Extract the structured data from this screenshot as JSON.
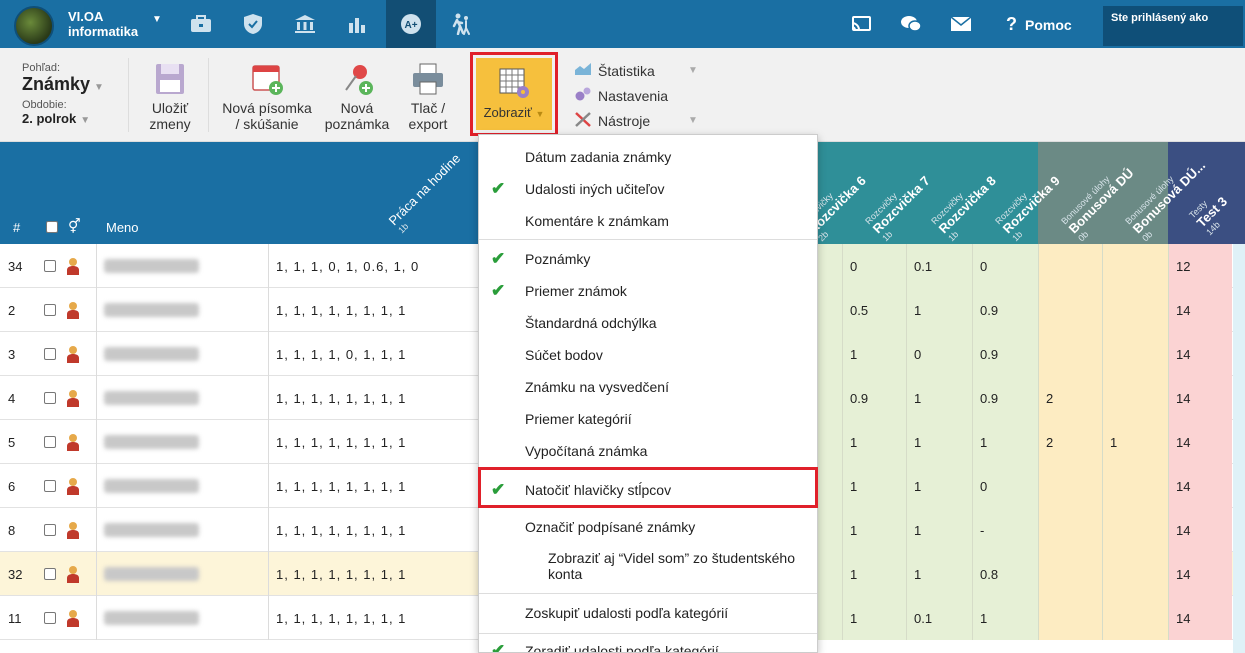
{
  "app": {
    "name_line1": "VI.OA",
    "name_line2": "informatika"
  },
  "nav": {
    "icons": [
      "briefcase-icon",
      "shield-icon",
      "bank-icon",
      "bar-chart-icon",
      "grades-icon",
      "walking-icon"
    ],
    "help_label": "Pomoc",
    "user_label": "Ste prihlásený ako"
  },
  "toolbar": {
    "view_caption": "Pohľad:",
    "view_value": "Známky",
    "period_caption": "Obdobie:",
    "period_value": "2. polrok",
    "save_label_1": "Uložiť",
    "save_label_2": "zmeny",
    "new_exam_1": "Nová písomka",
    "new_exam_2": "/ skúšanie",
    "new_note_1": "Nová",
    "new_note_2": "poznámka",
    "print_1": "Tlač /",
    "print_2": "export",
    "show_label": "Zobraziť",
    "side_statistics": "Štatistika",
    "side_settings": "Nastavenia",
    "side_tools": "Nástroje"
  },
  "table": {
    "col_num": "#",
    "col_name": "Meno",
    "col_work": {
      "name": "Práca na hodine",
      "points": "1b"
    },
    "rot_columns": [
      {
        "cat": "Rozcvičky",
        "name": "Rozcvička 6",
        "points": "2b"
      },
      {
        "cat": "Rozcvičky",
        "name": "Rozcvička 7",
        "points": "1b"
      },
      {
        "cat": "Rozcvičky",
        "name": "Rozcvička 8",
        "points": "1b"
      },
      {
        "cat": "Rozcvičky",
        "name": "Rozcvička 9",
        "points": "1b"
      },
      {
        "cat": "Bonusové úlohy",
        "name": "Bonusová DÚ",
        "points": "0b"
      },
      {
        "cat": "Bonusové úlohy",
        "name": "Bonusová DÚ...",
        "points": "0b"
      },
      {
        "cat": "Testy",
        "name": "Test 3",
        "points": "14b"
      }
    ],
    "rows": [
      {
        "num": "34",
        "work": "1, 1, 1, 0, 1, 0.6, 1, 0",
        "r6": "0",
        "r7": "0.1",
        "r8": "0",
        "b1": "",
        "b2": "",
        "t3": "12"
      },
      {
        "num": "2",
        "work": "1, 1, 1, 1, 1, 1, 1, 1",
        "r6": "0.5",
        "r7": "1",
        "r8": "0.9",
        "b1": "",
        "b2": "",
        "t3": "14"
      },
      {
        "num": "3",
        "work": "1, 1, 1, 1, 0, 1, 1, 1",
        "r6": "1",
        "r7": "0",
        "r8": "0.9",
        "b1": "",
        "b2": "",
        "t3": "14"
      },
      {
        "num": "4",
        "work": "1, 1, 1, 1, 1, 1, 1, 1",
        "r6": "0.9",
        "r7": "1",
        "r8": "0.9",
        "b1": "2",
        "b2": "",
        "t3": "14"
      },
      {
        "num": "5",
        "work": "1, 1, 1, 1, 1, 1, 1, 1",
        "r6": "1",
        "r7": "1",
        "r8": "1",
        "b1": "2",
        "b2": "1",
        "t3": "14"
      },
      {
        "num": "6",
        "work": "1, 1, 1, 1, 1, 1, 1, 1",
        "r6": "1",
        "r7": "1",
        "r8": "0",
        "b1": "",
        "b2": "",
        "t3": "14"
      },
      {
        "num": "8",
        "work": "1, 1, 1, 1, 1, 1, 1, 1",
        "r6": "1",
        "r7": "1",
        "r8": "-",
        "b1": "",
        "b2": "",
        "t3": "14"
      },
      {
        "num": "32",
        "work": "1, 1, 1, 1, 1, 1, 1, 1",
        "r6": "1",
        "r7": "1",
        "r8": "0.8",
        "b1": "",
        "b2": "",
        "t3": "14"
      },
      {
        "num": "11",
        "work": "1, 1, 1, 1, 1, 1, 1, 1",
        "r6": "1",
        "r7": "0.1",
        "r8": "1",
        "b1": "",
        "b2": "",
        "t3": "14"
      }
    ]
  },
  "dropdown": {
    "items": [
      {
        "label": "Dátum zadania známky",
        "checked": false
      },
      {
        "label": "Udalosti iných učiteľov",
        "checked": true
      },
      {
        "label": "Komentáre k známkam",
        "checked": false
      },
      {
        "label": "Poznámky",
        "checked": true
      },
      {
        "label": "Priemer známok",
        "checked": true
      },
      {
        "label": "Štandardná odchýlka",
        "checked": false
      },
      {
        "label": "Súčet bodov",
        "checked": false
      },
      {
        "label": "Známku na vysvedčení",
        "checked": false
      },
      {
        "label": "Priemer kategórií",
        "checked": false
      },
      {
        "label": "Vypočítaná známka",
        "checked": false
      },
      {
        "label": "Natočiť hlavičky stĺpcov",
        "checked": true
      },
      {
        "label": "Označiť podpísané známky",
        "checked": false
      },
      {
        "label": "Zobraziť aj “Videl som” zo študentského konta",
        "checked": false
      },
      {
        "label": "Zoskupiť udalosti podľa kategórií",
        "checked": false
      },
      {
        "label": "Zoradiť udalosti podľa kategórií",
        "checked": true
      }
    ]
  },
  "colors": {
    "accent": "#1a6fa3",
    "highlight": "#e0202a",
    "show_button": "#f6c03d",
    "check": "#2a9d3a"
  }
}
